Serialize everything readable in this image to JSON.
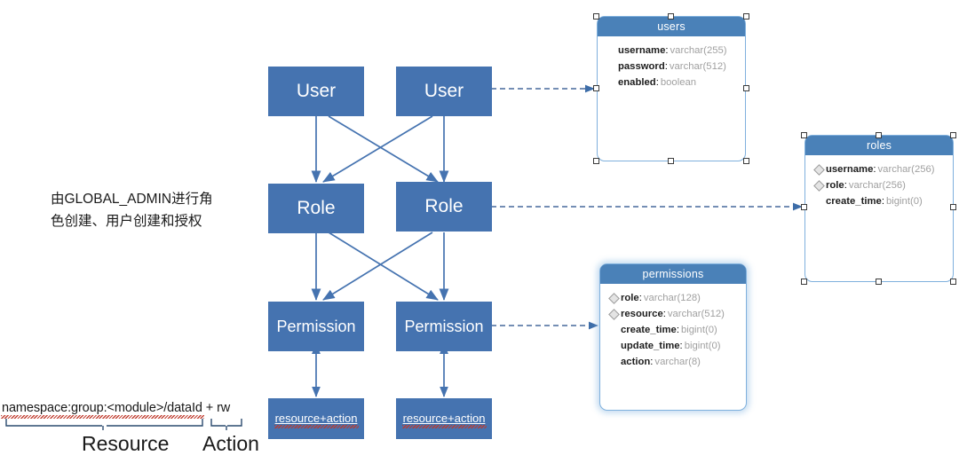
{
  "diagram": {
    "title_note": {
      "line1": "由GLOBAL_ADMIN进行角",
      "line2": "色创建、用户创建和授权"
    },
    "flow_boxes": [
      {
        "id": "user-left",
        "label": "User"
      },
      {
        "id": "user-right",
        "label": "User"
      },
      {
        "id": "role-left",
        "label": "Role"
      },
      {
        "id": "role-right",
        "label": "Role"
      },
      {
        "id": "permission-left",
        "label": "Permission"
      },
      {
        "id": "permission-right",
        "label": "Permission"
      },
      {
        "id": "resource-action-left",
        "label": "resource+action"
      },
      {
        "id": "resource-action-right",
        "label": "resource+action"
      }
    ],
    "annotation": {
      "expression": "namespace:group:<module>/dataId + rw",
      "expr_parts": {
        "resource": "namespace:group:<module>/dataId",
        "plus": " + ",
        "action": "rw"
      },
      "brace_labels": {
        "resource": "Resource",
        "action": "Action"
      }
    },
    "tables": [
      {
        "id": "users",
        "name": "users",
        "selected": true,
        "columns": [
          {
            "name": "username",
            "type": "varchar(255)",
            "indexed": false
          },
          {
            "name": "password",
            "type": "varchar(512)",
            "indexed": false
          },
          {
            "name": "enabled",
            "type": "boolean",
            "indexed": false
          }
        ]
      },
      {
        "id": "roles",
        "name": "roles",
        "selected": true,
        "columns": [
          {
            "name": "username",
            "type": "varchar(256)",
            "indexed": true
          },
          {
            "name": "role",
            "type": "varchar(256)",
            "indexed": true
          },
          {
            "name": "create_time",
            "type": "bigint(0)",
            "indexed": false
          }
        ]
      },
      {
        "id": "permissions",
        "name": "permissions",
        "selected": false,
        "columns": [
          {
            "name": "role",
            "type": "varchar(128)",
            "indexed": true
          },
          {
            "name": "resource",
            "type": "varchar(512)",
            "indexed": true
          },
          {
            "name": "create_time",
            "type": "bigint(0)",
            "indexed": false
          },
          {
            "name": "update_time",
            "type": "bigint(0)",
            "indexed": false
          },
          {
            "name": "action",
            "type": "varchar(8)",
            "indexed": false
          }
        ]
      }
    ],
    "colors": {
      "box_fill": "#4573b0",
      "table_header": "#4a81b8",
      "table_border": "#7fb0dd",
      "connector": "#4573b0",
      "dashed_connector": "#5b7fae",
      "squiggle": "#c0392b"
    }
  }
}
